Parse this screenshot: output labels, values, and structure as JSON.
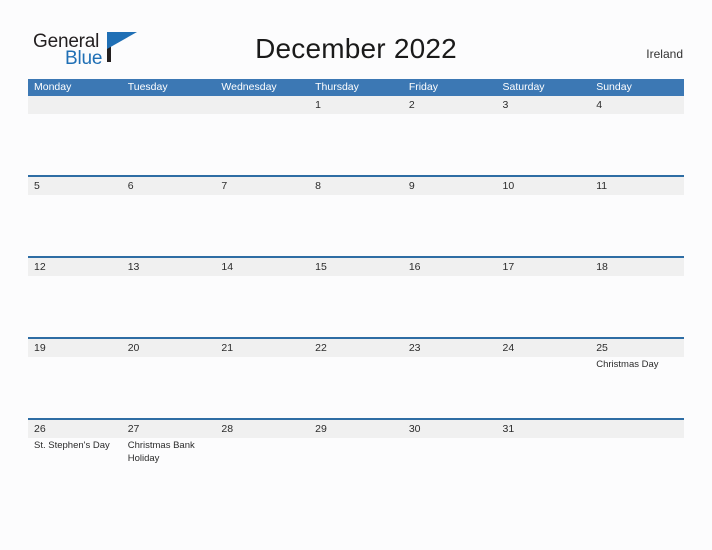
{
  "brand": {
    "name_part1": "General",
    "name_part2": "Blue",
    "flag_icon": "blue-flag-icon"
  },
  "header": {
    "title": "December 2022",
    "country": "Ireland"
  },
  "colors": {
    "header_blue": "#3c78b4",
    "rule_blue": "#2e6da4",
    "band_gray": "#f0f0f0",
    "page_background": "#fcfcfd",
    "brand_blue": "#1f6fb5",
    "text_dark": "#2b2b2b"
  },
  "calendar": {
    "weekdays": [
      "Monday",
      "Tuesday",
      "Wednesday",
      "Thursday",
      "Friday",
      "Saturday",
      "Sunday"
    ],
    "weeks": [
      [
        {
          "day": "",
          "events": []
        },
        {
          "day": "",
          "events": []
        },
        {
          "day": "",
          "events": []
        },
        {
          "day": "1",
          "events": []
        },
        {
          "day": "2",
          "events": []
        },
        {
          "day": "3",
          "events": []
        },
        {
          "day": "4",
          "events": []
        }
      ],
      [
        {
          "day": "5",
          "events": []
        },
        {
          "day": "6",
          "events": []
        },
        {
          "day": "7",
          "events": []
        },
        {
          "day": "8",
          "events": []
        },
        {
          "day": "9",
          "events": []
        },
        {
          "day": "10",
          "events": []
        },
        {
          "day": "11",
          "events": []
        }
      ],
      [
        {
          "day": "12",
          "events": []
        },
        {
          "day": "13",
          "events": []
        },
        {
          "day": "14",
          "events": []
        },
        {
          "day": "15",
          "events": []
        },
        {
          "day": "16",
          "events": []
        },
        {
          "day": "17",
          "events": []
        },
        {
          "day": "18",
          "events": []
        }
      ],
      [
        {
          "day": "19",
          "events": []
        },
        {
          "day": "20",
          "events": []
        },
        {
          "day": "21",
          "events": []
        },
        {
          "day": "22",
          "events": []
        },
        {
          "day": "23",
          "events": []
        },
        {
          "day": "24",
          "events": []
        },
        {
          "day": "25",
          "events": [
            "Christmas Day"
          ]
        }
      ],
      [
        {
          "day": "26",
          "events": [
            "St. Stephen's Day"
          ]
        },
        {
          "day": "27",
          "events": [
            "Christmas Bank Holiday"
          ]
        },
        {
          "day": "28",
          "events": []
        },
        {
          "day": "29",
          "events": []
        },
        {
          "day": "30",
          "events": []
        },
        {
          "day": "31",
          "events": []
        },
        {
          "day": "",
          "events": []
        }
      ]
    ]
  }
}
